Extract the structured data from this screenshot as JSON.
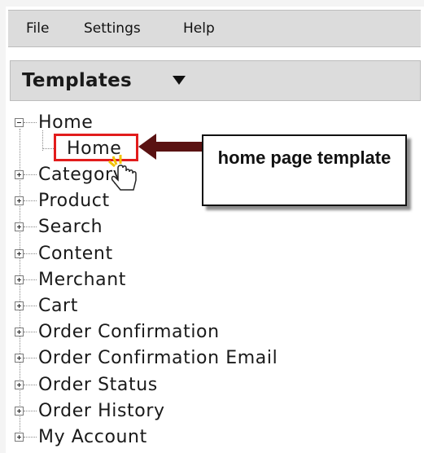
{
  "menu": {
    "items": [
      {
        "label": "File"
      },
      {
        "label": "Settings"
      },
      {
        "label": "Help"
      }
    ]
  },
  "panel": {
    "title": "Templates"
  },
  "tree": {
    "root": {
      "label": "Home",
      "child_label": "Home"
    },
    "nodes": [
      {
        "label": "Category"
      },
      {
        "label": "Product"
      },
      {
        "label": "Search"
      },
      {
        "label": "Content"
      },
      {
        "label": "Merchant"
      },
      {
        "label": "Cart"
      },
      {
        "label": "Order Confirmation"
      },
      {
        "label": "Order Confirmation Email"
      },
      {
        "label": "Order Status"
      },
      {
        "label": "Order History"
      },
      {
        "label": "My Account"
      }
    ]
  },
  "callout": {
    "text": "home page template"
  },
  "colors": {
    "highlight": "#e21c1c",
    "arrow": "#5a1212",
    "bar": "#dcdcdc"
  }
}
